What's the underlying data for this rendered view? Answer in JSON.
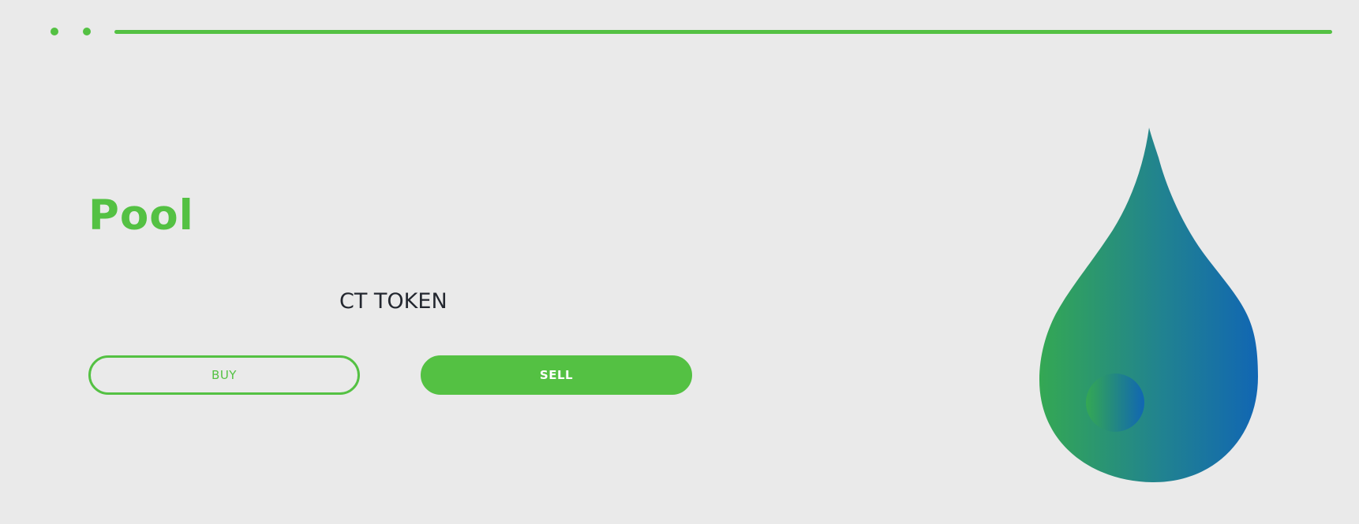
{
  "header": {
    "nav_dots": 2,
    "progress": 1.0
  },
  "main": {
    "title": "Pool",
    "token_name": "CT TOKEN",
    "buy_label": "BUY",
    "sell_label": "SELL"
  },
  "illustration": {
    "icon": "water-drop-icon",
    "gradient_start": "#34a853",
    "gradient_end": "#1166b3"
  },
  "colors": {
    "accent": "#54c143",
    "background": "#eaeaea",
    "text": "#23272f"
  }
}
